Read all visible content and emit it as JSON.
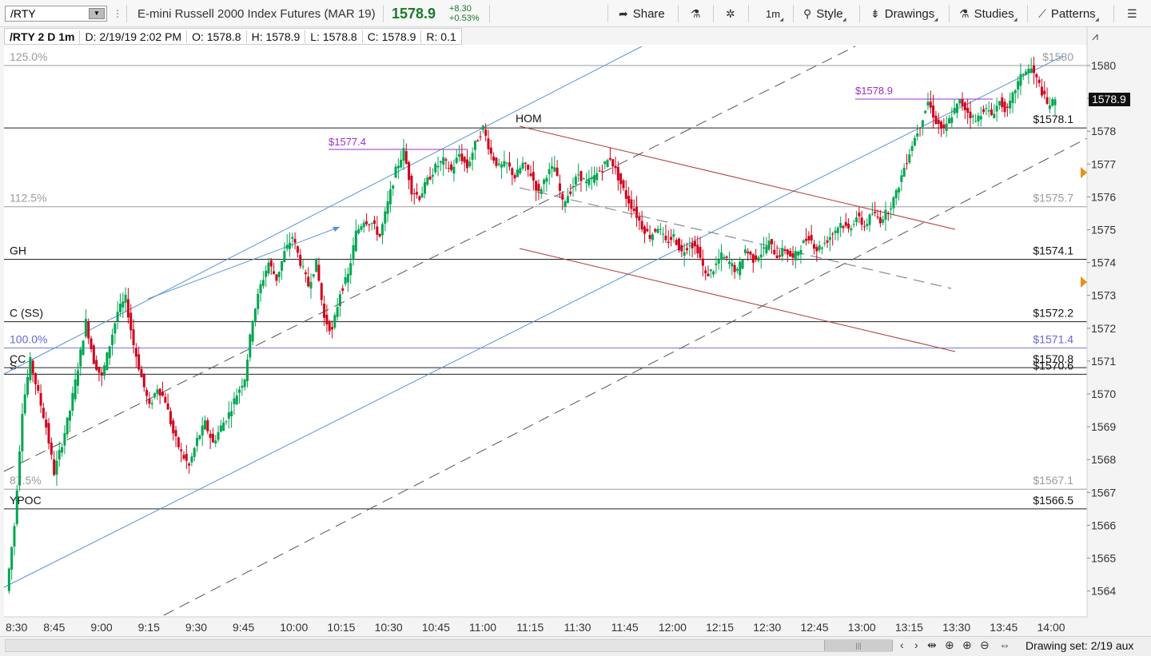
{
  "header": {
    "symbol": "/RTY",
    "description": "E-mini Russell 2000 Index Futures (MAR 19)",
    "last_price": "1578.9",
    "change_abs": "+8.30",
    "change_pct": "+0.53%",
    "buttons": {
      "share": "Share",
      "timeframe": "1m",
      "style": "Style",
      "drawings": "Drawings",
      "studies": "Studies",
      "patterns": "Patterns"
    },
    "icons": [
      "share-icon",
      "flask-icon",
      "gear-icon",
      "style-icon",
      "drawings-icon",
      "studies-icon",
      "patterns-icon",
      "menu-icon"
    ]
  },
  "info_bar": {
    "title": "/RTY 2 D 1m",
    "date": "D: 2/19/19 2:02 PM",
    "open": "O: 1578.8",
    "high": "H: 1578.9",
    "low": "L: 1578.8",
    "close": "C: 1578.9",
    "range": "R: 0.1"
  },
  "chart_data": {
    "type": "candlestick",
    "symbol": "/RTY",
    "aggregation": "1m",
    "ylim": [
      1563.5,
      1580.5
    ],
    "y_ticks": [
      1564,
      1565,
      1566,
      1567,
      1568,
      1569,
      1570,
      1571,
      1572,
      1573,
      1574,
      1575,
      1576,
      1577,
      1578,
      1579,
      1580
    ],
    "x_range_minutes": [
      0,
      340
    ],
    "x_ticks": [
      {
        "label": "8:30",
        "t": 0
      },
      {
        "label": "8:45",
        "t": 15
      },
      {
        "label": "9:00",
        "t": 30
      },
      {
        "label": "9:15",
        "t": 45
      },
      {
        "label": "9:30",
        "t": 60
      },
      {
        "label": "9:45",
        "t": 75
      },
      {
        "label": "10:00",
        "t": 90
      },
      {
        "label": "10:15",
        "t": 105
      },
      {
        "label": "10:30",
        "t": 120
      },
      {
        "label": "10:45",
        "t": 135
      },
      {
        "label": "11:00",
        "t": 150
      },
      {
        "label": "11:15",
        "t": 165
      },
      {
        "label": "11:30",
        "t": 180
      },
      {
        "label": "11:45",
        "t": 195
      },
      {
        "label": "12:00",
        "t": 210
      },
      {
        "label": "12:15",
        "t": 225
      },
      {
        "label": "12:30",
        "t": 240
      },
      {
        "label": "12:45",
        "t": 255
      },
      {
        "label": "13:00",
        "t": 270
      },
      {
        "label": "13:15",
        "t": 285
      },
      {
        "label": "13:30",
        "t": 300
      },
      {
        "label": "13:45",
        "t": 315
      },
      {
        "label": "14:00",
        "t": 330
      }
    ],
    "current_price_label": "1578.9",
    "up_color": "#00a650",
    "down_color": "#d0021b",
    "price_path": [
      [
        0,
        1564.0
      ],
      [
        3,
        1566.0
      ],
      [
        6,
        1569.5
      ],
      [
        9,
        1571.0
      ],
      [
        12,
        1570.0
      ],
      [
        15,
        1569.0
      ],
      [
        18,
        1567.6
      ],
      [
        21,
        1568.5
      ],
      [
        24,
        1569.5
      ],
      [
        27,
        1570.8
      ],
      [
        30,
        1572.2
      ],
      [
        33,
        1571.0
      ],
      [
        36,
        1570.5
      ],
      [
        39,
        1571.5
      ],
      [
        42,
        1572.5
      ],
      [
        45,
        1572.9
      ],
      [
        48,
        1571.5
      ],
      [
        51,
        1570.5
      ],
      [
        54,
        1569.6
      ],
      [
        57,
        1570.2
      ],
      [
        60,
        1569.8
      ],
      [
        63,
        1568.8
      ],
      [
        66,
        1568.2
      ],
      [
        69,
        1567.8
      ],
      [
        72,
        1568.6
      ],
      [
        75,
        1569.1
      ],
      [
        78,
        1568.5
      ],
      [
        81,
        1569.0
      ],
      [
        84,
        1569.4
      ],
      [
        87,
        1570.0
      ],
      [
        90,
        1570.5
      ],
      [
        93,
        1572.3
      ],
      [
        96,
        1573.3
      ],
      [
        99,
        1574.0
      ],
      [
        102,
        1573.5
      ],
      [
        105,
        1574.3
      ],
      [
        108,
        1574.8
      ],
      [
        111,
        1574.0
      ],
      [
        114,
        1573.3
      ],
      [
        117,
        1574.0
      ],
      [
        120,
        1572.3
      ],
      [
        123,
        1571.9
      ],
      [
        126,
        1573.1
      ],
      [
        129,
        1573.6
      ],
      [
        132,
        1574.9
      ],
      [
        135,
        1575.3
      ],
      [
        138,
        1575.2
      ],
      [
        141,
        1574.8
      ],
      [
        144,
        1575.8
      ],
      [
        147,
        1576.8
      ],
      [
        150,
        1577.4
      ],
      [
        153,
        1576.2
      ],
      [
        156,
        1576.0
      ],
      [
        159,
        1576.5
      ],
      [
        162,
        1576.9
      ],
      [
        165,
        1577.1
      ],
      [
        168,
        1576.8
      ],
      [
        171,
        1577.3
      ],
      [
        174,
        1576.9
      ],
      [
        177,
        1577.6
      ],
      [
        180,
        1578.1
      ],
      [
        183,
        1577.3
      ],
      [
        186,
        1576.9
      ],
      [
        189,
        1577.0
      ],
      [
        192,
        1576.6
      ],
      [
        195,
        1577.0
      ],
      [
        198,
        1576.7
      ],
      [
        201,
        1576.1
      ],
      [
        204,
        1576.7
      ],
      [
        207,
        1576.9
      ],
      [
        210,
        1575.8
      ],
      [
        213,
        1576.2
      ],
      [
        216,
        1576.7
      ],
      [
        219,
        1576.4
      ],
      [
        222,
        1576.6
      ],
      [
        225,
        1576.9
      ],
      [
        228,
        1577.2
      ],
      [
        231,
        1576.6
      ],
      [
        234,
        1576.0
      ],
      [
        237,
        1575.6
      ],
      [
        240,
        1575.1
      ],
      [
        243,
        1574.8
      ],
      [
        246,
        1575.1
      ],
      [
        249,
        1574.6
      ],
      [
        252,
        1574.8
      ],
      [
        255,
        1574.3
      ],
      [
        258,
        1574.6
      ],
      [
        261,
        1574.4
      ],
      [
        264,
        1573.6
      ],
      [
        267,
        1573.8
      ],
      [
        270,
        1574.2
      ],
      [
        273,
        1574.0
      ],
      [
        276,
        1573.7
      ],
      [
        279,
        1574.4
      ],
      [
        282,
        1574.1
      ],
      [
        285,
        1574.3
      ],
      [
        288,
        1574.6
      ],
      [
        291,
        1574.2
      ],
      [
        294,
        1574.4
      ],
      [
        297,
        1574.1
      ],
      [
        300,
        1574.5
      ],
      [
        303,
        1574.8
      ],
      [
        306,
        1574.4
      ],
      [
        309,
        1574.6
      ],
      [
        312,
        1574.9
      ],
      [
        315,
        1575.2
      ],
      [
        318,
        1575.0
      ],
      [
        321,
        1575.4
      ],
      [
        324,
        1575.1
      ],
      [
        327,
        1575.5
      ],
      [
        330,
        1575.3
      ],
      [
        333,
        1575.6
      ],
      [
        336,
        1576.1
      ],
      [
        339,
        1576.9
      ],
      [
        342,
        1577.6
      ],
      [
        345,
        1578.2
      ],
      [
        348,
        1578.9
      ],
      [
        351,
        1578.3
      ],
      [
        354,
        1578.0
      ],
      [
        357,
        1578.5
      ],
      [
        360,
        1578.9
      ],
      [
        363,
        1578.6
      ],
      [
        366,
        1578.3
      ],
      [
        369,
        1578.7
      ],
      [
        372,
        1578.5
      ],
      [
        375,
        1578.9
      ],
      [
        378,
        1578.6
      ],
      [
        381,
        1579.3
      ],
      [
        384,
        1579.8
      ],
      [
        387,
        1579.9
      ],
      [
        390,
        1579.4
      ],
      [
        393,
        1578.8
      ],
      [
        396,
        1578.9
      ]
    ],
    "horizontal_levels": [
      {
        "left_label": "125.0%",
        "right_label": "$1580",
        "price": 1580.0,
        "color": "#9e9e9e"
      },
      {
        "left_label": "",
        "right_label": "$1578.1",
        "price": 1578.1,
        "color": "#222222"
      },
      {
        "left_label": "112.5%",
        "right_label": "$1575.7",
        "price": 1575.7,
        "color": "#9e9e9e"
      },
      {
        "left_label": "GH",
        "right_label": "$1574.1",
        "price": 1574.1,
        "color": "#222222"
      },
      {
        "left_label": "C (SS)",
        "right_label": "$1572.2",
        "price": 1572.2,
        "color": "#222222"
      },
      {
        "left_label": "100.0%",
        "right_label": "$1571.4",
        "price": 1571.4,
        "color": "#7777dd"
      },
      {
        "left_label": "CC",
        "right_label": "$1570.8",
        "price": 1570.8,
        "color": "#222222"
      },
      {
        "left_label": "S",
        "right_label": "$1570.6",
        "price": 1570.6,
        "color": "#222222"
      },
      {
        "left_label": "87.5%",
        "right_label": "$1567.1",
        "price": 1567.1,
        "color": "#9e9e9e"
      },
      {
        "left_label": "YPOC",
        "right_label": "$1566.5",
        "price": 1566.5,
        "color": "#222222"
      }
    ],
    "annotations": [
      {
        "text": "HOM",
        "color": "#111111"
      },
      {
        "text": "$1577.4",
        "color": "#9b30c8"
      },
      {
        "text": "$1578.9",
        "color": "#9b30c8"
      }
    ]
  },
  "footer": {
    "drawing_set": "Drawing set: 2/19 aux"
  }
}
